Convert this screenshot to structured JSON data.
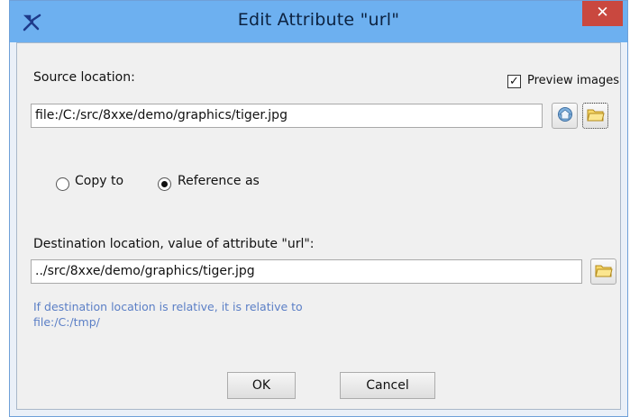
{
  "window": {
    "title": "Edit Attribute \"url\"",
    "close_glyph": "✕",
    "app_icon": "tools-icon",
    "titlebar_color": "#6db0f0",
    "close_color": "#c9483f"
  },
  "source": {
    "label": "Source location:",
    "preview_label": "Preview images",
    "preview_checked": true,
    "value": "file:/C:/src/8xxe/demo/graphics/tiger.jpg",
    "url_button_icon": "url-chooser-icon",
    "browse_button_icon": "folder-icon"
  },
  "mode": {
    "copy_label": "Copy to",
    "reference_label": "Reference as",
    "selected": "reference"
  },
  "destination": {
    "label": "Destination location, value of attribute \"url\":",
    "value": "../src/8xxe/demo/graphics/tiger.jpg",
    "browse_button_icon": "folder-icon",
    "hint_line1": "If destination location is relative, it is relative to",
    "hint_line2": "file:/C:/tmp/",
    "hint_color": "#5b7fc6"
  },
  "buttons": {
    "ok": "OK",
    "cancel": "Cancel"
  }
}
